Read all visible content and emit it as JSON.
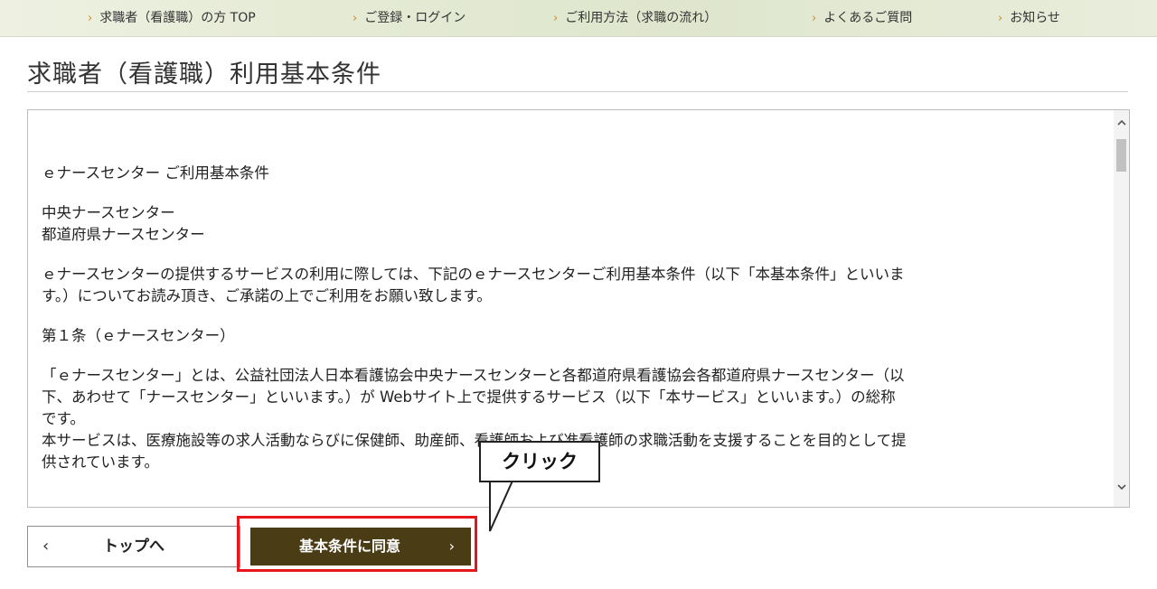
{
  "nav": {
    "items": [
      {
        "label": "求職者（看護職）の方 TOP"
      },
      {
        "label": "ご登録・ログイン"
      },
      {
        "label": "ご利用方法（求職の流れ）"
      },
      {
        "label": "よくあるご質問"
      },
      {
        "label": "お知らせ"
      }
    ],
    "chevron": "›"
  },
  "page": {
    "title": "求職者（看護職）利用基本条件"
  },
  "terms": {
    "heading": "ｅナースセンター ご利用基本条件",
    "org_line1": "中央ナースセンター",
    "org_line2": "都道府県ナースセンター",
    "intro_line1": "ｅナースセンターの提供するサービスの利用に際しては、下記のｅナースセンターご利用基本条件（以下「本基本条件」といいま",
    "intro_line2": "す。）についてお読み頂き、ご承諾の上でご利用をお願い致します。",
    "article1_title": "第１条（ｅナースセンター）",
    "article1_line1": "「ｅナースセンター」とは、公益社団法人日本看護協会中央ナースセンターと各都道府県看護協会各都道府県ナースセンター（以",
    "article1_line2": "下、あわせて「ナースセンター」といいます。）が Webサイト上で提供するサービス（以下「本サービス」といいます。）の総称",
    "article1_line3": "です。",
    "article1_line4": "本サービスは、医療施設等の求人活動ならびに保健師、助産師、看護師および准看護師の求職活動を支援することを目的として提",
    "article1_line5": "供されています。"
  },
  "scrollbar": {
    "up_icon": "up-arrow",
    "down_icon": "down-arrow"
  },
  "buttons": {
    "top_label": "トップへ",
    "top_chevron": "‹",
    "agree_label": "基本条件に同意",
    "agree_chevron": "›"
  },
  "callout": {
    "text": "クリック"
  },
  "colors": {
    "agree_button": "#4a3d16",
    "highlight": "#e8151b",
    "nav_chevron": "#d08a1e"
  }
}
